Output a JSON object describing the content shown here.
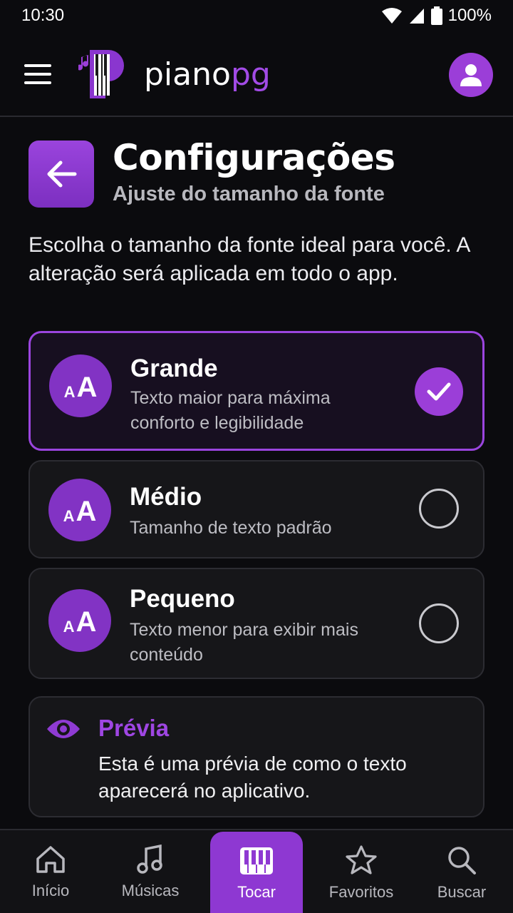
{
  "status": {
    "time": "10:30",
    "battery": "100%"
  },
  "header": {
    "logo_part1": "piano",
    "logo_part2": "pg",
    "brand_color": "#9b3ed8"
  },
  "page": {
    "title": "Configurações",
    "subtitle": "Ajuste do tamanho da fonte",
    "intro": "Escolha o tamanho da fonte ideal para você. A alteração será aplicada em todo o app."
  },
  "options": [
    {
      "icon_small": "A",
      "icon_big": "A",
      "title": "Grande",
      "description": "Texto maior para máxima conforto e legibilidade",
      "selected": true
    },
    {
      "icon_small": "A",
      "icon_big": "A",
      "title": "Médio",
      "description": "Tamanho de texto padrão",
      "selected": false
    },
    {
      "icon_small": "A",
      "icon_big": "A",
      "title": "Pequeno",
      "description": "Texto menor para exibir mais conteúdo",
      "selected": false
    }
  ],
  "preview": {
    "icon": "eye-icon",
    "title": "Prévia",
    "text": "Esta é uma prévia de como o texto aparecerá no aplicativo."
  },
  "nav": [
    {
      "icon": "home-icon",
      "label": "Início",
      "active": false
    },
    {
      "icon": "music-note-icon",
      "label": "Músicas",
      "active": false
    },
    {
      "icon": "piano-icon",
      "label": "Tocar",
      "active": true
    },
    {
      "icon": "star-icon",
      "label": "Favoritos",
      "active": false
    },
    {
      "icon": "search-icon",
      "label": "Buscar",
      "active": false
    }
  ]
}
